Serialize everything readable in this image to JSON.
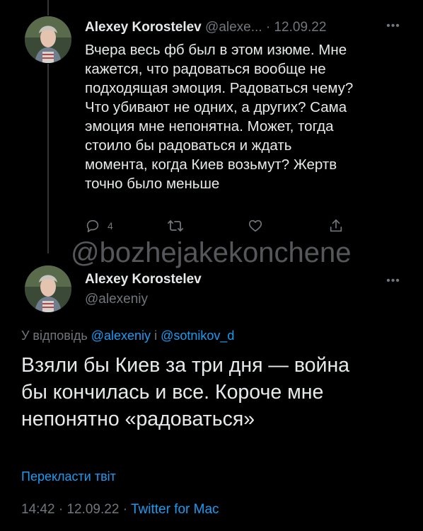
{
  "tweet1": {
    "name": "Alexey Korostelev",
    "handle": "@alexe...",
    "separator": "·",
    "date": "12.09.22",
    "more_icon": "more-horizontal-icon",
    "text": "Вчера весь фб был в этом изюме. Мне\nкажется, что радоваться вообще не\nподходящая эмоция. Радоваться чему?\nЧто убивают не одних, а других? Сама\nэмоция мне непонятна. Может, тогда\nстоило бы радоваться и ждать\nмомента, когда Киев возьмут? Жертв\nточно было меньше",
    "actions": {
      "reply_icon": "reply-icon",
      "reply_count": "4",
      "retweet_icon": "retweet-icon",
      "like_icon": "heart-icon",
      "share_icon": "share-icon"
    }
  },
  "watermark": "@bozhejakekonchene",
  "tweet2": {
    "name": "Alexey Korostelev",
    "handle": "@alexeniy",
    "more_icon": "more-horizontal-icon",
    "reply_prefix": "У відповідь",
    "reply_mention_1": "@alexeniy",
    "reply_join": "і",
    "reply_mention_2": "@sotnikov_d",
    "text": "Взяли бы Киев за три дня — война\nбы кончилась и все. Короче мне\nнепонятно «радоваться»",
    "translate_label": "Перекласти твіт",
    "time": "14:42",
    "separator": "·",
    "date": "12.09.22",
    "separator2": "·",
    "source": "Twitter for Mac"
  },
  "colors": {
    "background": "#000000",
    "text": "#e7e9ea",
    "secondary": "#71767b",
    "accent": "#1d9bf0"
  }
}
